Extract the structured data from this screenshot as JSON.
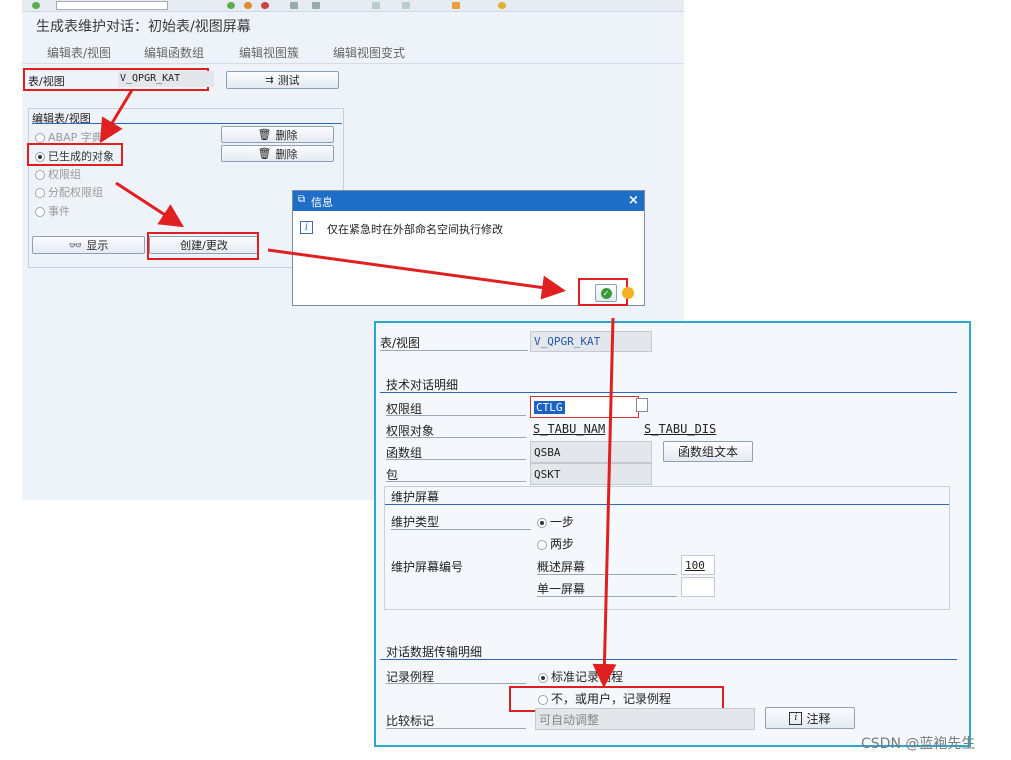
{
  "screen1": {
    "title": "生成表维护对话：初始表/视图屏幕",
    "menu": [
      "编辑表/视图",
      "编辑函数组",
      "编辑视图簇",
      "编辑视图变式"
    ],
    "table_view_label": "表/视图",
    "table_view_value": "V_QPGR_KAT",
    "test_button": "测试",
    "group_title": "编辑表/视图",
    "options": [
      "ABAP 字典",
      "已生成的对象",
      "权限组",
      "分配权限组",
      "事件"
    ],
    "delete_button_1": "删除",
    "delete_button_2": "删除",
    "display_button": "显示",
    "create_button": "创建/更改"
  },
  "dialog": {
    "title": "信息",
    "message": "仅在紧急时在外部命名空间执行修改"
  },
  "screen2": {
    "table_view_label": "表/视图",
    "table_view_value": "V_QPGR_KAT",
    "tech_section": "技术对话明细",
    "auth_group_label": "权限组",
    "auth_group_value": "CTLG",
    "auth_object_label": "权限对象",
    "auth_object_value_1": "S_TABU_NAM",
    "auth_object_value_2": "S_TABU_DIS",
    "func_group_label": "函数组",
    "func_group_value": "QSBA",
    "func_group_text_button": "函数组文本",
    "package_label": "包",
    "package_value": "QSKT",
    "maint_section": "维护屏幕",
    "maint_type_label": "维护类型",
    "maint_type_one": "一步",
    "maint_type_two": "两步",
    "maint_screen_no_label": "维护屏幕编号",
    "overview_screen_label": "概述屏幕",
    "overview_screen_value": "100",
    "single_screen_label": "单一屏幕",
    "single_screen_value": "",
    "transfer_section": "对话数据传输明细",
    "record_routine_label": "记录例程",
    "record_standard": "标准记录例程",
    "record_none": "不，或用户，记录例程",
    "compare_flag_label": "比较标记",
    "compare_flag_value": "可自动调整",
    "note_button": "注释"
  },
  "watermark": "CSDN @蓝袍先生",
  "colors": {
    "annotation_red": "#e02020",
    "dialog_blue": "#1f6fc8",
    "frame_cyan": "#2aa8d0"
  }
}
